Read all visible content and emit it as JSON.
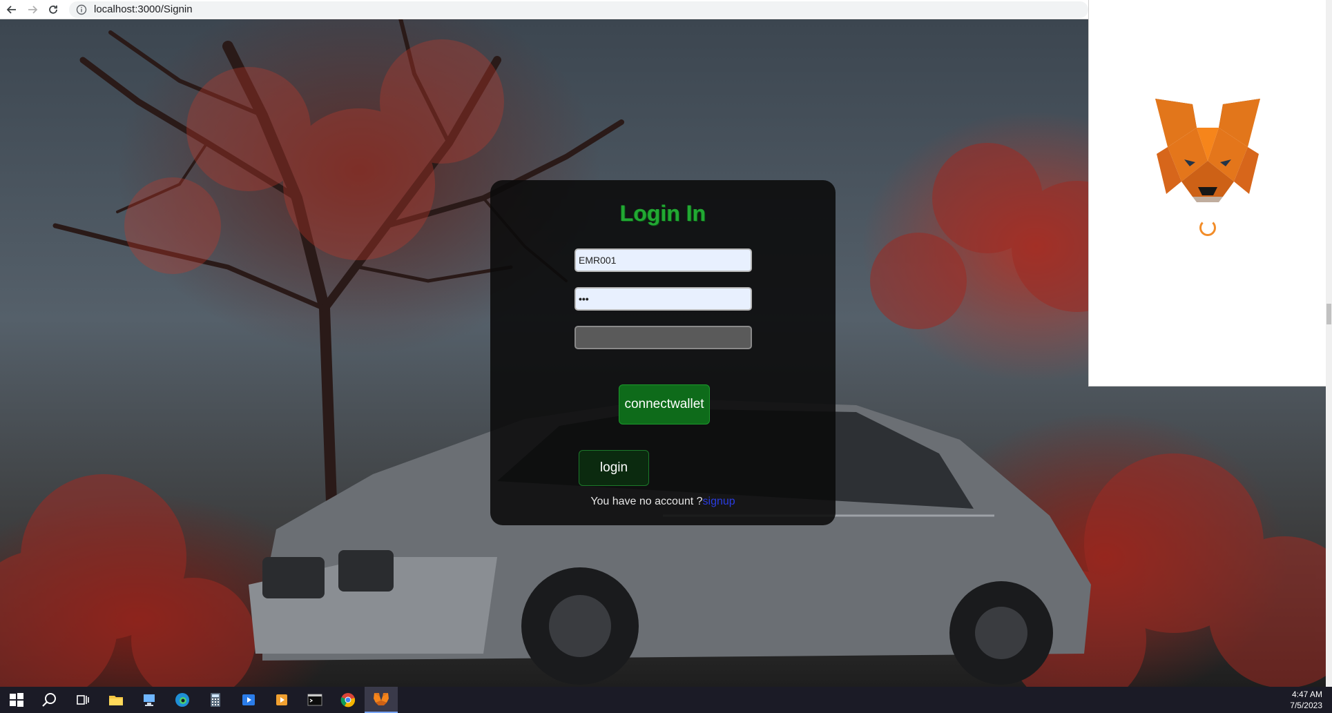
{
  "browser": {
    "url": "localhost:3000/Signin",
    "icons": [
      "back-arrow-icon",
      "forward-arrow-icon",
      "reload-icon",
      "info-icon"
    ]
  },
  "login": {
    "title": "Login In",
    "username_value": "EMR001",
    "password_value": "•••",
    "third_field_value": "",
    "connect_button": "connectwallet",
    "login_button": "login",
    "no_account_text": "You have no account ?",
    "signup_link": "signup",
    "title_color": "#22a833",
    "connect_color": "#0e6b1a"
  },
  "metamask": {
    "icon": "metamask-fox-icon",
    "state": "loading"
  },
  "taskbar": {
    "items": [
      "windows-start-icon",
      "search-icon",
      "task-view-icon",
      "file-explorer-icon",
      "pc-icon",
      "edge-icon",
      "calculator-icon",
      "media-player-icon",
      "video-icon",
      "terminal-icon",
      "chrome-icon",
      "metamask-icon"
    ],
    "time": "4:47 AM",
    "date": "7/5/2023"
  }
}
